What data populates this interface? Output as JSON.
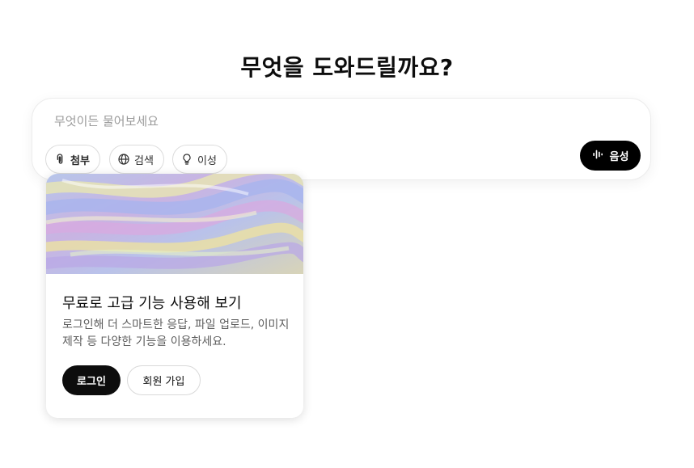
{
  "heading": "무엇을 도와드릴까요?",
  "composer": {
    "placeholder": "무엇이든 물어보세요",
    "value": "",
    "tools": {
      "attach_label": "첨부",
      "search_label": "검색",
      "reason_label": "이성"
    },
    "voice_label": "음성"
  },
  "promo": {
    "title": "무료로 고급 기능 사용해 보기",
    "description": "로그인해 더 스마트한 응답, 파일 업로드, 이미지 제작 등 다양한 기능을 이용하세요.",
    "login_label": "로그인",
    "signup_label": "회원 가입"
  },
  "icons": {
    "attach": "paperclip-icon",
    "search": "globe-icon",
    "reason": "lightbulb-icon",
    "voice": "waveform-icon"
  },
  "colors": {
    "primary_button": "#0d0d0d",
    "placeholder_text": "#9b9b9b",
    "pill_border": "#dcdcdc"
  }
}
